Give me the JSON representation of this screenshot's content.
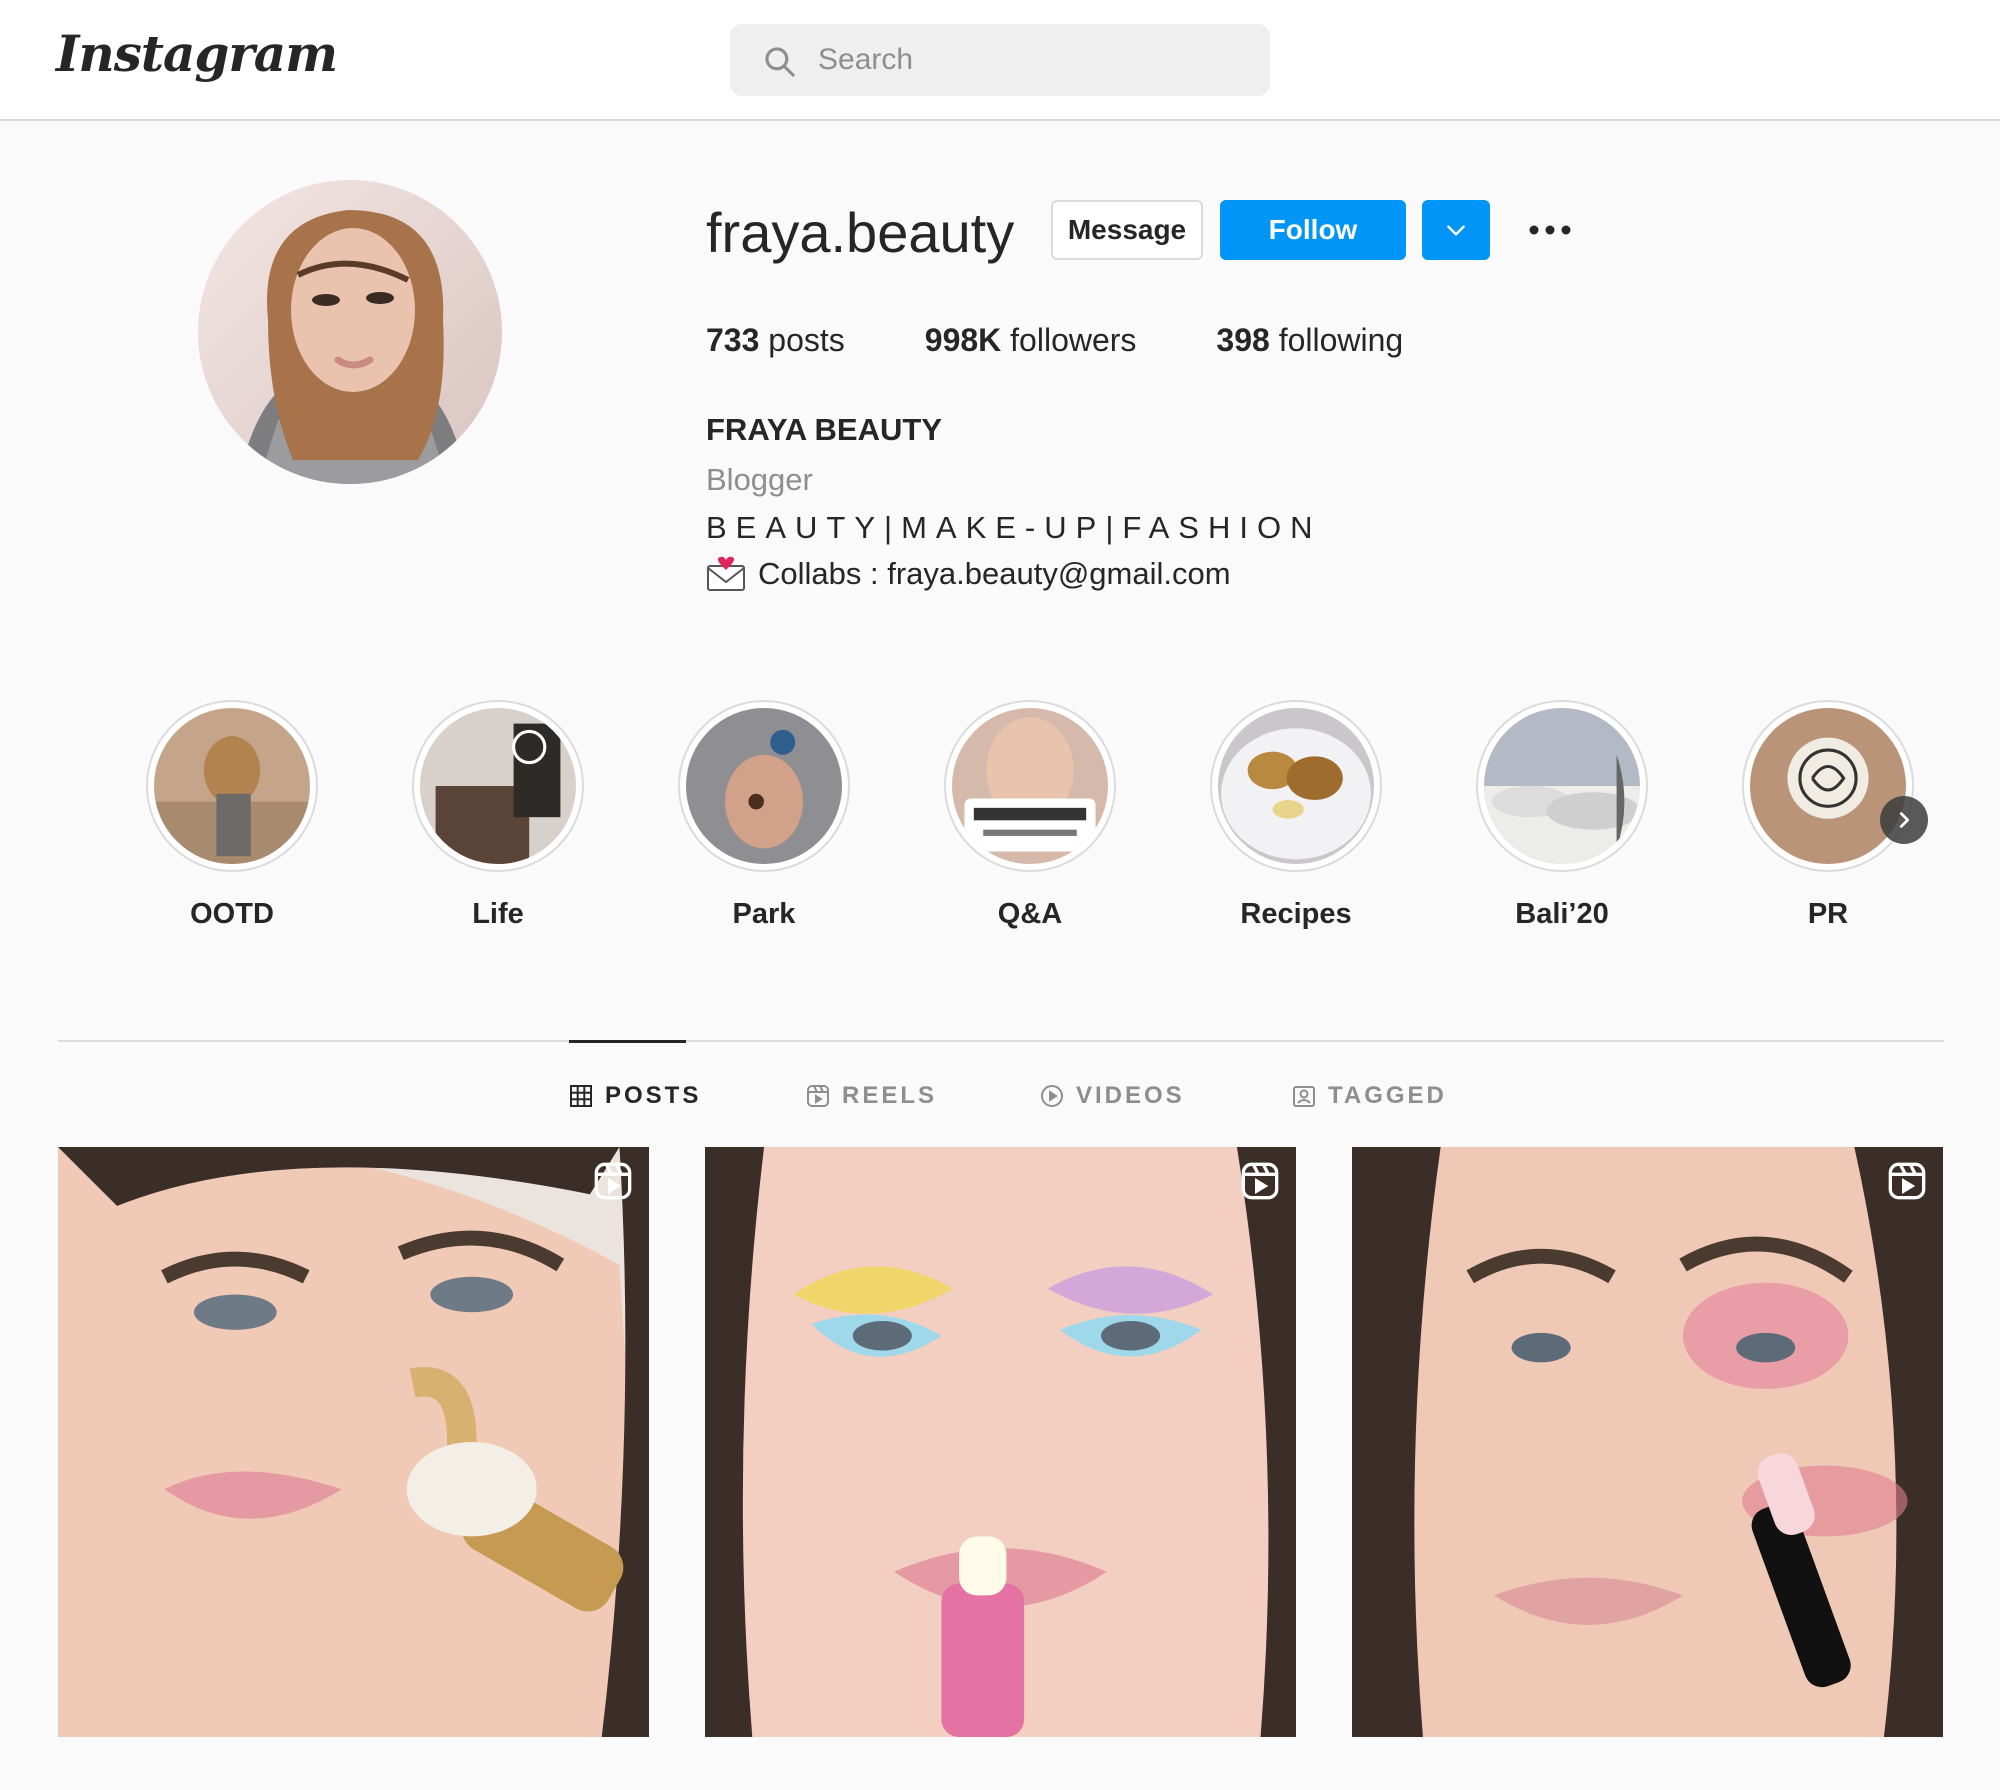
{
  "nav": {
    "logo": "Instagram",
    "search_placeholder": "Search"
  },
  "profile": {
    "username": "fraya.beauty",
    "message_label": "Message",
    "follow_label": "Follow",
    "posts_count": "733",
    "posts_label": "posts",
    "followers_count": "998K",
    "followers_label": "followers",
    "following_count": "398",
    "following_label": "following",
    "full_name": "FRAYA BEAUTY",
    "category": "Blogger",
    "bio": "BEAUTY|MAKE-UP|FASHION",
    "contact": "Collabs : fraya.beauty@gmail.com"
  },
  "highlights": [
    {
      "label": "OOTD"
    },
    {
      "label": "Life"
    },
    {
      "label": "Park"
    },
    {
      "label": "Q&A"
    },
    {
      "label": "Recipes"
    },
    {
      "label": "Bali’20"
    },
    {
      "label": "PR"
    }
  ],
  "tabs": [
    {
      "label": "POSTS",
      "active": true
    },
    {
      "label": "REELS",
      "active": false
    },
    {
      "label": "VIDEOS",
      "active": false
    },
    {
      "label": "TAGGED",
      "active": false
    }
  ],
  "posts": [
    {
      "type": "reel"
    },
    {
      "type": "reel"
    },
    {
      "type": "reel"
    }
  ],
  "colors": {
    "accent": "#0095f6",
    "text": "#262626",
    "muted": "#8e8e8e",
    "border": "#dbdbdb",
    "background": "#fafafa"
  }
}
